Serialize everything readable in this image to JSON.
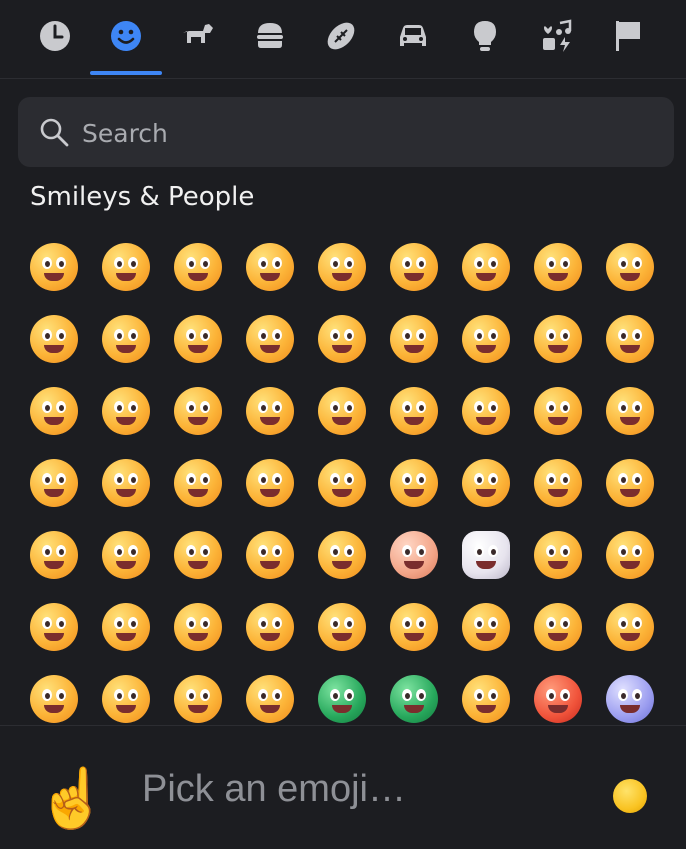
{
  "tabs": [
    {
      "name": "tab-recent",
      "icon": "clock-icon"
    },
    {
      "name": "tab-smileys",
      "icon": "smiley-icon",
      "selected": true
    },
    {
      "name": "tab-animals",
      "icon": "dog-icon"
    },
    {
      "name": "tab-food",
      "icon": "burger-icon"
    },
    {
      "name": "tab-activities",
      "icon": "football-icon"
    },
    {
      "name": "tab-travel",
      "icon": "car-icon"
    },
    {
      "name": "tab-objects",
      "icon": "lightbulb-icon"
    },
    {
      "name": "tab-symbols",
      "icon": "symbols-icon"
    },
    {
      "name": "tab-flags",
      "icon": "flag-icon"
    }
  ],
  "colors": {
    "accent": "#3e86f5",
    "background": "#1c1d21",
    "search_bg": "#2b2c31",
    "icon": "#c9cace"
  },
  "search": {
    "placeholder": "Search"
  },
  "section_title": "Smileys & People",
  "emojis": [
    "😀",
    "😃",
    "😄",
    "😁",
    "😆",
    "😅",
    "🤣",
    "😂",
    "🙂",
    "🙃",
    "🫠",
    "😉",
    "😊",
    "😇",
    "🥰",
    "😍",
    "🤩",
    "😘",
    "😗",
    "☺️",
    "😚",
    "😙",
    "🥲",
    "😋",
    "😛",
    "😜",
    "🤪",
    "😝",
    "🤑",
    "🤗",
    "🤭",
    "🫢",
    "🫣",
    "🤫",
    "🤔",
    "🫡",
    "🤐",
    "🤨",
    "😐",
    "😑",
    "😶",
    "🫥",
    "😶‍🌫️",
    "😏",
    "😒",
    "🙄",
    "😬",
    "😮‍💨",
    "🤥",
    "😳",
    "😌",
    "😔",
    "😪",
    "🤤",
    "😴",
    "😷",
    "🤒",
    "🤕",
    "🤢",
    "🤮",
    "🤧",
    "🥵",
    "🥶"
  ],
  "footer": {
    "hand": "☝️",
    "placeholder": "Pick an emoji…",
    "skin_tone_label": "skin tone"
  }
}
